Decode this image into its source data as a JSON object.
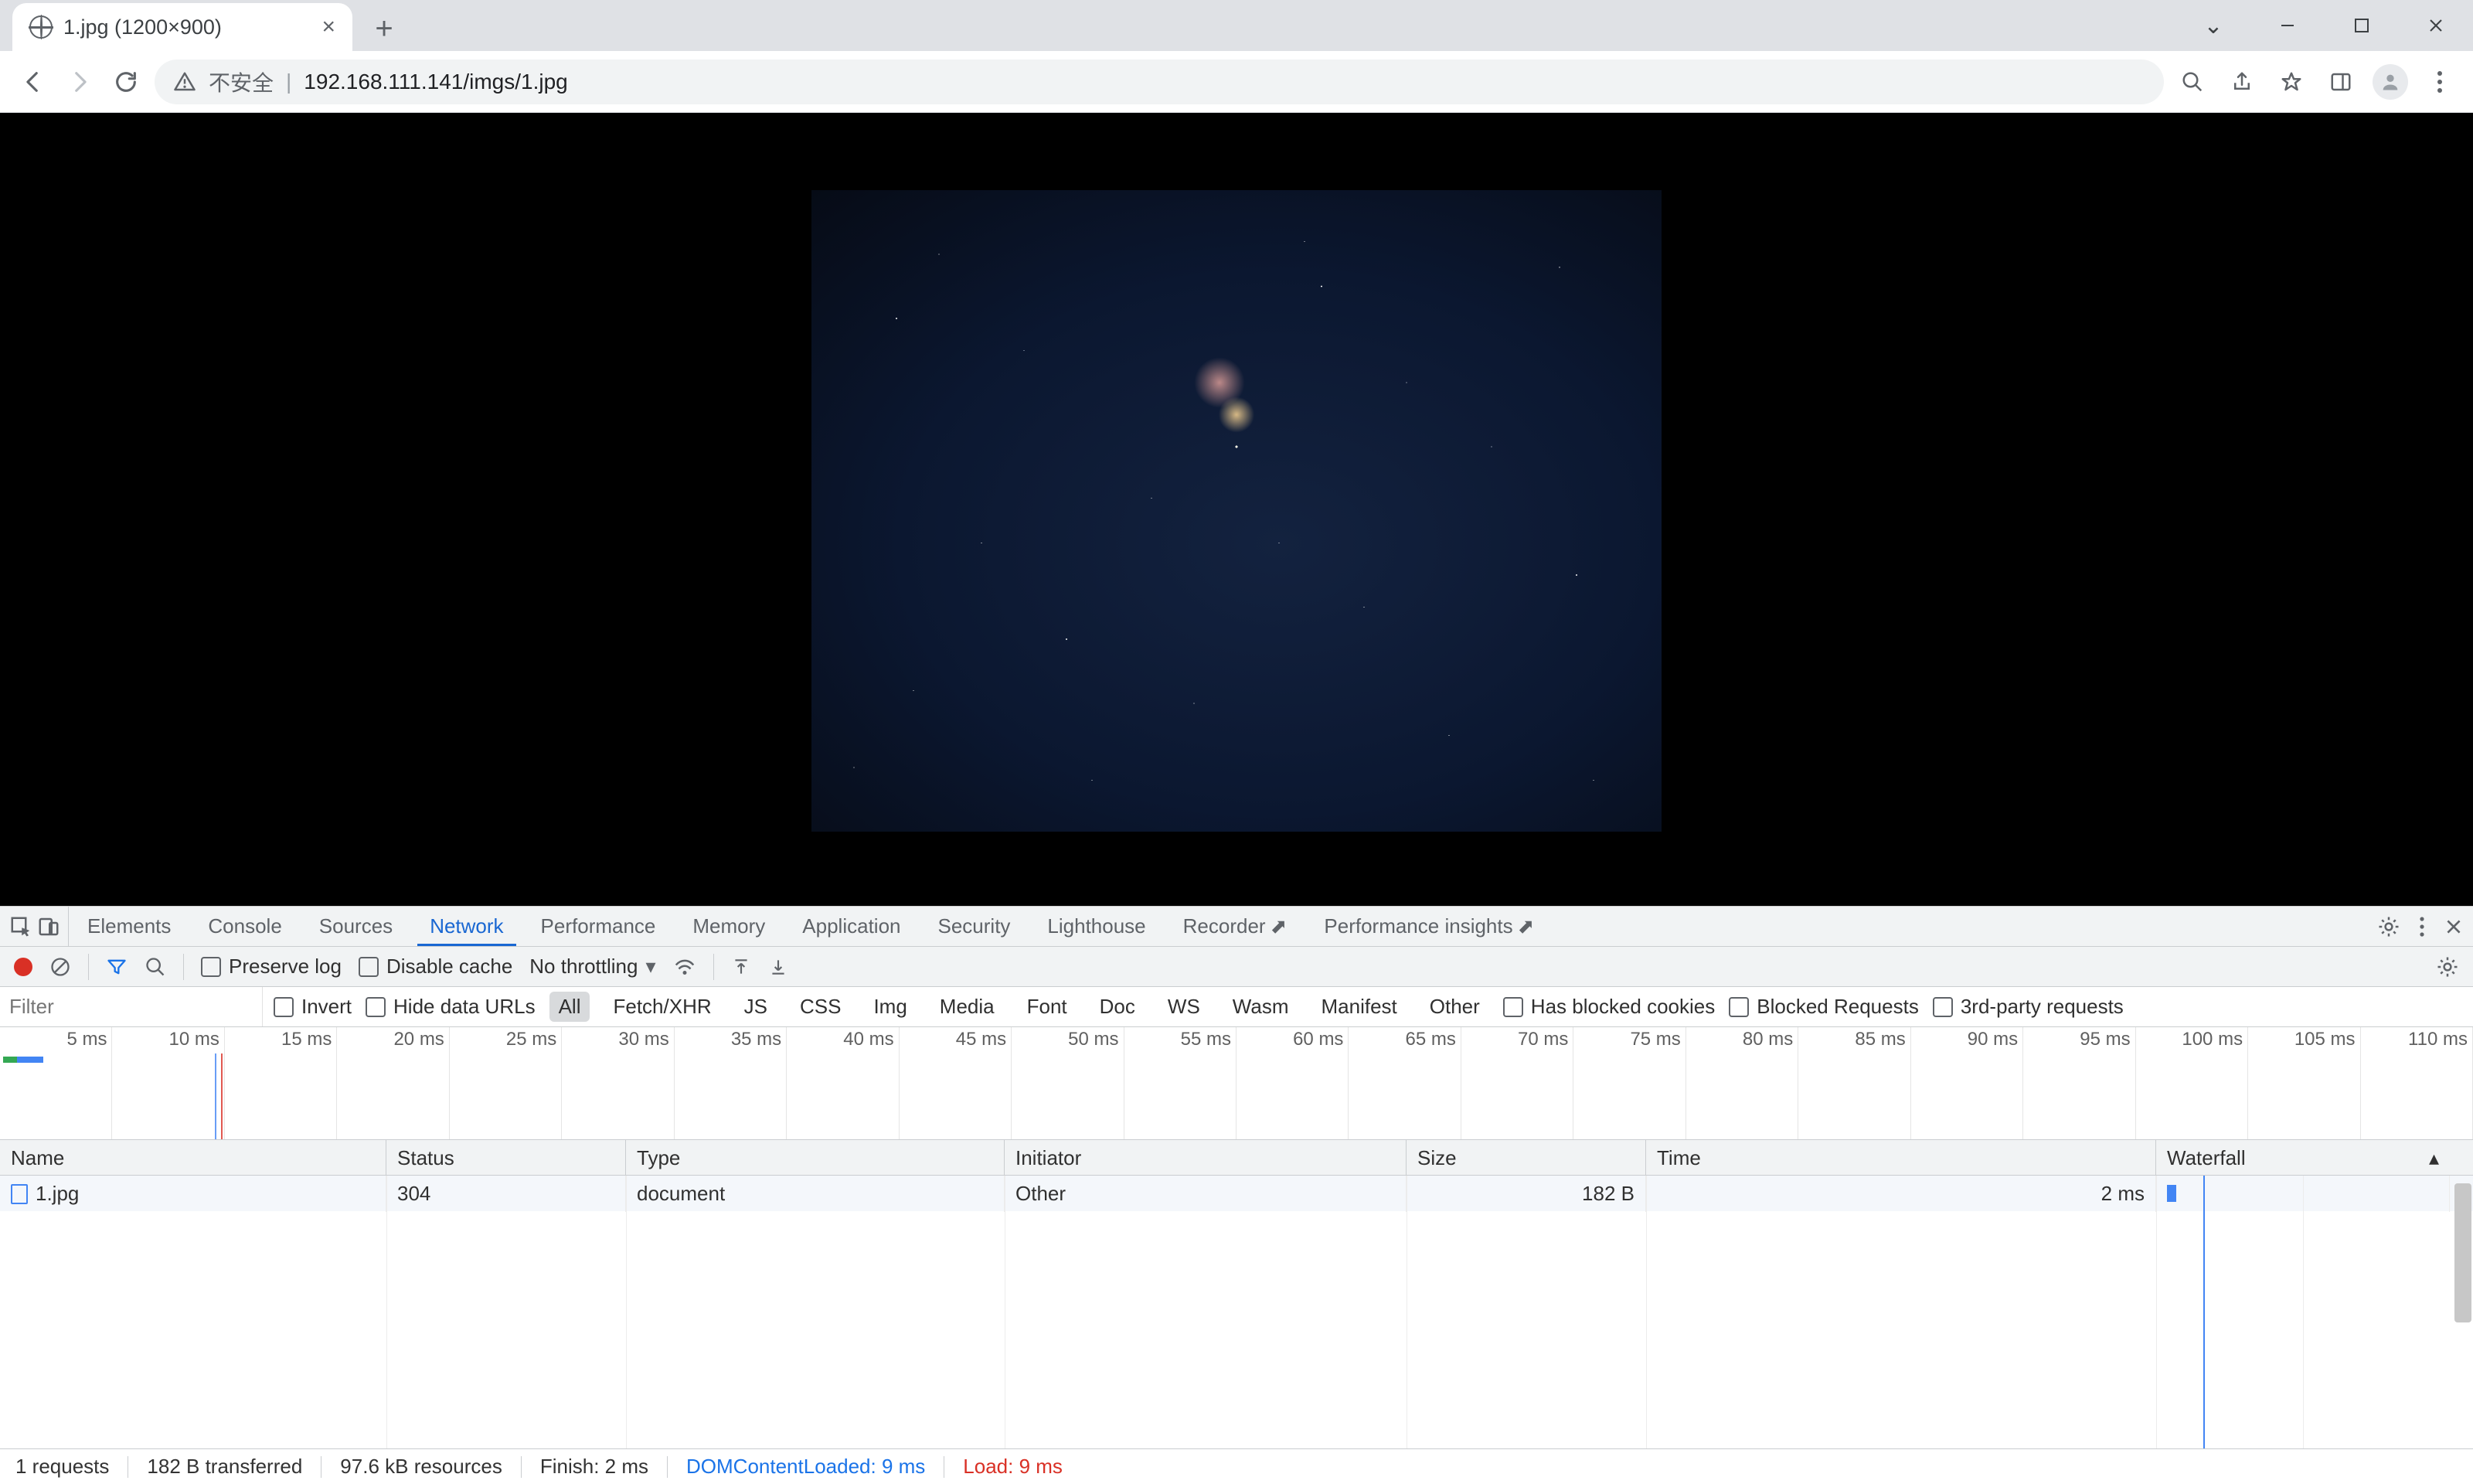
{
  "tab": {
    "title": "1.jpg (1200×900)"
  },
  "omnibox": {
    "not_secure": "不安全",
    "url": "192.168.111.141/imgs/1.jpg"
  },
  "devtools": {
    "tabs": [
      "Elements",
      "Console",
      "Sources",
      "Network",
      "Performance",
      "Memory",
      "Application",
      "Security",
      "Lighthouse",
      "Recorder",
      "Performance insights"
    ],
    "active": "Network",
    "toolbar": {
      "preserve_log": "Preserve log",
      "disable_cache": "Disable cache",
      "throttling": "No throttling"
    },
    "filter_placeholder": "Filter",
    "filter_checks": {
      "invert": "Invert",
      "hide_data_urls": "Hide data URLs"
    },
    "filter_types": [
      "All",
      "Fetch/XHR",
      "JS",
      "CSS",
      "Img",
      "Media",
      "Font",
      "Doc",
      "WS",
      "Wasm",
      "Manifest",
      "Other"
    ],
    "filter_type_selected": "All",
    "filter_extra": {
      "blocked_cookies": "Has blocked cookies",
      "blocked_req": "Blocked Requests",
      "thirdparty": "3rd-party requests"
    },
    "timeline_ticks": [
      "5 ms",
      "10 ms",
      "15 ms",
      "20 ms",
      "25 ms",
      "30 ms",
      "35 ms",
      "40 ms",
      "45 ms",
      "50 ms",
      "55 ms",
      "60 ms",
      "65 ms",
      "70 ms",
      "75 ms",
      "80 ms",
      "85 ms",
      "90 ms",
      "95 ms",
      "100 ms",
      "105 ms",
      "110 ms"
    ],
    "columns": [
      "Name",
      "Status",
      "Type",
      "Initiator",
      "Size",
      "Time",
      "Waterfall"
    ],
    "rows": [
      {
        "name": "1.jpg",
        "status": "304",
        "type": "document",
        "initiator": "Other",
        "size": "182 B",
        "time": "2 ms"
      }
    ],
    "status": {
      "requests": "1 requests",
      "transferred": "182 B transferred",
      "resources": "97.6 kB resources",
      "finish": "Finish: 2 ms",
      "dcl": "DOMContentLoaded: 9 ms",
      "load": "Load: 9 ms"
    }
  }
}
